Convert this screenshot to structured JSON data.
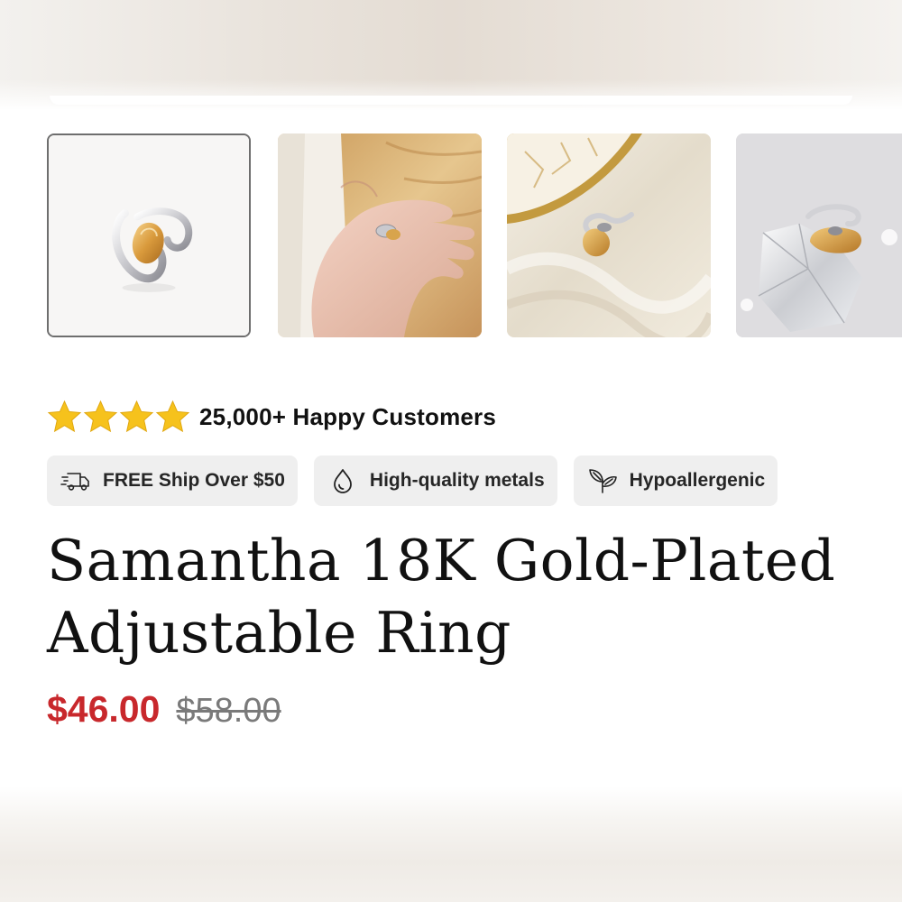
{
  "gallery": {
    "thumbnails": [
      {
        "label": "ring-product-white-background",
        "selected": true
      },
      {
        "label": "ring-worn-on-hand-sand",
        "selected": false
      },
      {
        "label": "ring-on-satin-with-gold-plate",
        "selected": false
      },
      {
        "label": "ring-on-crystal",
        "selected": false
      }
    ]
  },
  "rating": {
    "stars": 4,
    "star_color": "#f6c21c",
    "text": "25,000+ Happy Customers"
  },
  "badges": [
    {
      "icon": "delivery-truck-icon",
      "label": "FREE Ship Over $50"
    },
    {
      "icon": "water-drop-icon",
      "label": "High-quality metals"
    },
    {
      "icon": "leaf-icon",
      "label": "Hypoallergenic"
    }
  ],
  "product": {
    "title": "Samantha 18K Gold-Plated Adjustable Ring",
    "price": "$46.00",
    "compare_at_price": "$58.00",
    "price_color": "#c8282c"
  }
}
